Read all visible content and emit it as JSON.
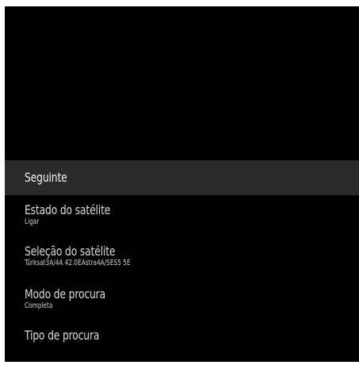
{
  "menu": {
    "items": [
      {
        "title": "Seguinte",
        "value": ""
      },
      {
        "title": "Estado do satélite",
        "value": "Ligar"
      },
      {
        "title": "Seleção do satélite",
        "value": "Türksat3A/4A 42.0EAstra4A/SES5 5E"
      },
      {
        "title": "Modo de procura",
        "value": "Completa"
      },
      {
        "title": "Tipo de procura",
        "value": ""
      }
    ]
  },
  "colors": {
    "background": "#000000",
    "selected_row": "#2b2b2b",
    "text": "#d9d9d9"
  }
}
